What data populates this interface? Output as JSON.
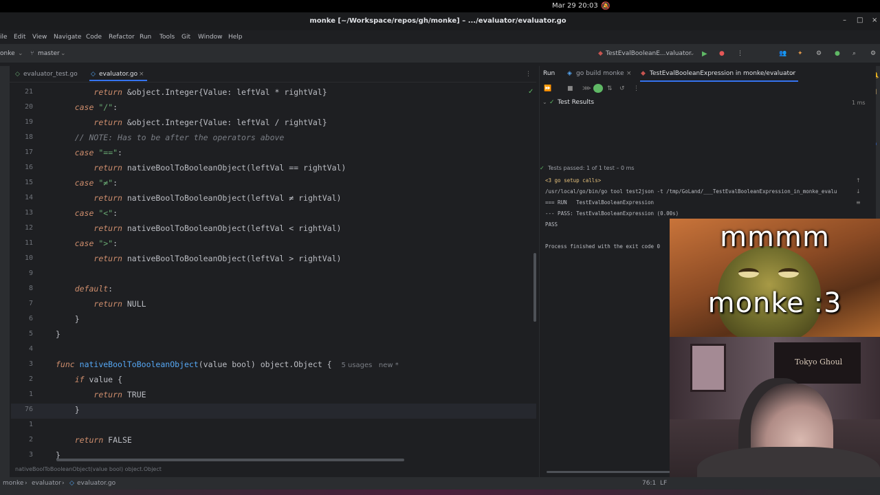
{
  "system": {
    "clock": "Mar 29  20:03",
    "bell_icon": "bell-off-icon"
  },
  "window": {
    "title": "monke [~/Workspace/repos/gh/monke] – .../evaluator/evaluator.go",
    "minimize": "–",
    "maximize": "□",
    "close": "×"
  },
  "menu": {
    "items": [
      "ile",
      "Edit",
      "View",
      "Navigate",
      "Code",
      "Refactor",
      "Run",
      "Tools",
      "Git",
      "Window",
      "Help"
    ]
  },
  "toolbar": {
    "project": "onke",
    "branch": "master",
    "run_config": "TestEvalBooleanE...valuator"
  },
  "editor_tabs": [
    {
      "label": "evaluator_test.go"
    },
    {
      "label": "evaluator.go"
    }
  ],
  "code_lines": [
    {
      "num": "21",
      "html": "        <span class='kw'>return</span> &amp;object.Integer{Value: leftVal * rightVal}"
    },
    {
      "num": "20",
      "html": "    <span class='kw'>case</span> <span class='str'>\"/\"</span>:"
    },
    {
      "num": "19",
      "html": "        <span class='kw'>return</span> &amp;object.Integer{Value: leftVal / rightVal}"
    },
    {
      "num": "18",
      "html": "    <span class='cmt'>// NOTE: Has to be after the operators above</span>"
    },
    {
      "num": "17",
      "html": "    <span class='kw'>case</span> <span class='str'>\"==\"</span>:"
    },
    {
      "num": "16",
      "html": "        <span class='kw'>return</span> nativeBoolToBooleanObject(leftVal == rightVal)"
    },
    {
      "num": "15",
      "html": "    <span class='kw'>case</span> <span class='str'>\"≠\"</span>:"
    },
    {
      "num": "14",
      "html": "        <span class='kw'>return</span> nativeBoolToBooleanObject(leftVal ≠ rightVal)"
    },
    {
      "num": "13",
      "html": "    <span class='kw'>case</span> <span class='str'>\"&lt;\"</span>:"
    },
    {
      "num": "12",
      "html": "        <span class='kw'>return</span> nativeBoolToBooleanObject(leftVal &lt; rightVal)"
    },
    {
      "num": "11",
      "html": "    <span class='kw'>case</span> <span class='str'>\"&gt;\"</span>:"
    },
    {
      "num": "10",
      "html": "        <span class='kw'>return</span> nativeBoolToBooleanObject(leftVal &gt; rightVal)"
    },
    {
      "num": "9",
      "html": ""
    },
    {
      "num": "8",
      "html": "    <span class='kw'>default</span>:"
    },
    {
      "num": "7",
      "html": "        <span class='kw'>return</span> NULL"
    },
    {
      "num": "6",
      "html": "    }"
    },
    {
      "num": "5",
      "html": "}"
    },
    {
      "num": "4",
      "html": ""
    },
    {
      "num": "3",
      "html": "<span class='kw'>func</span> <span class='fn'>nativeBoolToBooleanObject</span>(value bool) object.Object {  <span class='hint'>5 usages   new *</span>"
    },
    {
      "num": "2",
      "html": "    <span class='kw'>if</span> value {"
    },
    {
      "num": "1",
      "html": "        <span class='kw'>return</span> TRUE"
    },
    {
      "num": "76",
      "html": "    }"
    },
    {
      "num": "1",
      "html": ""
    },
    {
      "num": "2",
      "html": "    <span class='kw'>return</span> FALSE"
    },
    {
      "num": "3",
      "html": "}"
    }
  ],
  "breadcrumb_hint": "nativeBoolToBooleanObject(value bool) object.Object",
  "run_panel": {
    "tabs": [
      "Run",
      "go build monke",
      "TestEvalBooleanExpression in monke/evaluator"
    ],
    "test_results_label": "Test Results",
    "duration": "1 ms",
    "tests_passed": "Tests passed: 1 of 1 test – 0 ms",
    "console": [
      "<3 go setup calls>",
      "/usr/local/go/bin/go tool test2json -t /tmp/GoLand/___TestEvalBooleanExpression_in_monke_evalu",
      "=== RUN   TestEvalBooleanExpression",
      "--- PASS: TestEvalBooleanExpression (0.00s)",
      "PASS",
      "",
      "Process finished with the exit code 0"
    ]
  },
  "status": {
    "crumb_project": "monke",
    "crumb_dir": "evaluator",
    "crumb_file": "evaluator.go",
    "position": "76:1",
    "line_sep": "LF"
  },
  "overlay": {
    "caption_top": "mmmm",
    "caption_bottom": "monke :3",
    "poster_text": "Tokyo Ghoul"
  },
  "colors": {
    "accent": "#3574f0",
    "keyword": "#cf8e6d",
    "function": "#56a8f5",
    "string": "#6aab73",
    "comment": "#7a7e85"
  }
}
